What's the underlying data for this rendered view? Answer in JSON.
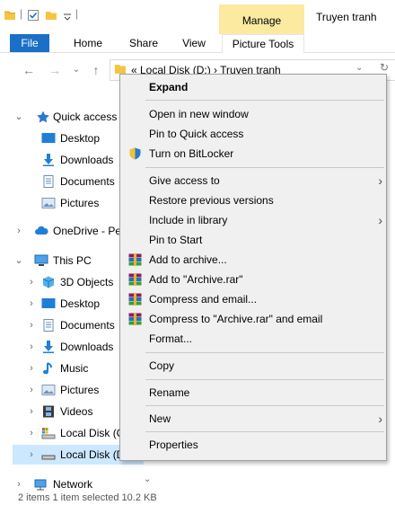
{
  "window": {
    "contextual_tab_group": "Manage",
    "app_title": "Truyen tranh"
  },
  "ribbon": {
    "tabs": [
      "File",
      "Home",
      "Share",
      "View",
      "Picture Tools"
    ]
  },
  "address_bar": {
    "path": "«  Local Disk (D:)  ›  Truyen tranh"
  },
  "nav_pane": {
    "items": [
      {
        "label": "Quick access",
        "icon": "star-icon"
      },
      {
        "label": "Desktop",
        "icon": "desktop-icon"
      },
      {
        "label": "Downloads",
        "icon": "download-icon"
      },
      {
        "label": "Documents",
        "icon": "document-icon"
      },
      {
        "label": "Pictures",
        "icon": "pictures-icon"
      },
      {
        "label": "OneDrive - Pe",
        "icon": "cloud-icon"
      },
      {
        "label": "This PC",
        "icon": "computer-icon"
      },
      {
        "label": "3D Objects",
        "icon": "cube-icon"
      },
      {
        "label": "Desktop",
        "icon": "desktop-icon"
      },
      {
        "label": "Documents",
        "icon": "document-icon"
      },
      {
        "label": "Downloads",
        "icon": "download-icon"
      },
      {
        "label": "Music",
        "icon": "music-icon"
      },
      {
        "label": "Pictures",
        "icon": "pictures-icon"
      },
      {
        "label": "Videos",
        "icon": "film-icon"
      },
      {
        "label": "Local Disk (C",
        "icon": "drive-icon"
      },
      {
        "label": "Local Disk (D:)",
        "icon": "drive-icon"
      },
      {
        "label": "Network",
        "icon": "network-icon"
      }
    ]
  },
  "context_menu": {
    "items": [
      {
        "label": "Expand",
        "bold": true
      },
      {
        "label": "Open in new window"
      },
      {
        "label": "Pin to Quick access"
      },
      {
        "label": "Turn on BitLocker",
        "icon": "shield-icon"
      },
      {
        "label": "Give access to",
        "submenu": true
      },
      {
        "label": "Restore previous versions"
      },
      {
        "label": "Include in library",
        "submenu": true
      },
      {
        "label": "Pin to Start"
      },
      {
        "label": "Add to archive...",
        "icon": "winrar-icon"
      },
      {
        "label": "Add to \"Archive.rar\"",
        "icon": "winrar-icon"
      },
      {
        "label": "Compress and email...",
        "icon": "winrar-icon"
      },
      {
        "label": "Compress to \"Archive.rar\" and email",
        "icon": "winrar-icon"
      },
      {
        "label": "Format..."
      },
      {
        "label": "Copy"
      },
      {
        "label": "Rename"
      },
      {
        "label": "New",
        "submenu": true
      },
      {
        "label": "Properties"
      }
    ],
    "submenu_arrow": "›"
  },
  "status_bar": {
    "text": "2 items    1 item selected  10.2 KB"
  },
  "colors": {
    "accent": "#1a6fc7",
    "manage_tab": "#fbeaa0",
    "selection": "#cce8ff",
    "menu_bg": "#f0f0f0"
  }
}
